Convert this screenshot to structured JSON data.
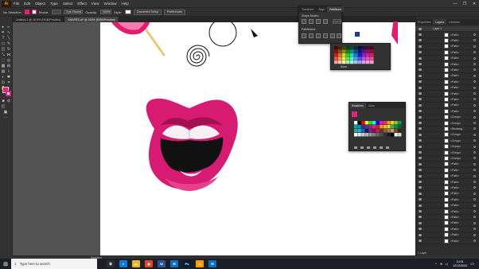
{
  "app": {
    "logo": "Ai"
  },
  "menu": [
    "File",
    "Edit",
    "Object",
    "Type",
    "Select",
    "Effect",
    "View",
    "Window",
    "Help"
  ],
  "window_buttons": [
    "—",
    "❐",
    "✕"
  ],
  "controlbar": {
    "selection": "No Selection",
    "stroke_label": "Stroke:",
    "stroke_value": "",
    "stroke_profile": "3 pt. Round",
    "opacity_label": "Opacity:",
    "opacity_value": "100%",
    "style_label": "Style:",
    "doc_setup": "Document Setup",
    "preferences": "Preferences",
    "fill_color": "#e4207a"
  },
  "doc_tabs": [
    {
      "label": "Untitled-1 @ 16.5% (RGB/Preview)",
      "active": false
    },
    {
      "label": "SHAPES.ai* @ 100% (RGB/Preview)",
      "active": true
    }
  ],
  "pathfinder_panel": {
    "tabs": [
      "Transform",
      "Align",
      "Pathfinder"
    ],
    "shape_modes_label": "Shape Modes:",
    "pathfinders_label": "Pathfinders:",
    "expand_label": "Expand"
  },
  "color_panel": {
    "tabs": [
      "Color"
    ],
    "name_label": "None"
  },
  "swatches_panel": {
    "tabs": [
      "Swatches",
      "Color"
    ]
  },
  "right_panel": {
    "tabs": [
      "Properties",
      "Layers",
      "Libraries"
    ],
    "layer_name": "Layer 1",
    "footer": "1 Layer",
    "rows": [
      "<Path>",
      "<Path>",
      "<Path>",
      "<Path>",
      "<Path>",
      "<Path>",
      "<Path>",
      "<Path>",
      "<Path>",
      "<Path>",
      "<Path>",
      "<Path>",
      "<Path>",
      "<Path>",
      "<Group>",
      "<Group>",
      "<Rectang...",
      "<Group>",
      "<Group>",
      "<Group>",
      "<Group>",
      "<Group>",
      "<Path>",
      "<Path>",
      "<Path>",
      "<Path>",
      "<Path>",
      "<Path>",
      "<Path>",
      "<Path>",
      "<Path>",
      "<Path>",
      "<Path>",
      "<Path>",
      "<Path>",
      "<Path>"
    ]
  },
  "statusbar": {
    "tool": "Selection"
  },
  "taskbar": {
    "search_placeholder": "Type here to search",
    "time": "14:01",
    "date": "12/12/2020",
    "apps": [
      {
        "name": "task-view",
        "color": "#2a2d33",
        "glyph": "⧉"
      },
      {
        "name": "edge",
        "color": "#0f7ad8",
        "glyph": "e"
      },
      {
        "name": "file-explorer",
        "color": "#e8b62a",
        "glyph": "▬"
      },
      {
        "name": "chrome",
        "color": "#e2452d",
        "glyph": "◉"
      },
      {
        "name": "word",
        "color": "#2b579a",
        "glyph": "W"
      },
      {
        "name": "mail",
        "color": "#0e6fc9",
        "glyph": "✉"
      },
      {
        "name": "photoshop",
        "color": "#001e36",
        "glyph": "Ps"
      },
      {
        "name": "illustrator",
        "color": "#ff9a00",
        "glyph": "Ai"
      },
      {
        "name": "mail-2",
        "color": "#0e6fc9",
        "glyph": "✉"
      }
    ]
  },
  "colors": {
    "lip_pink": "#d81b72",
    "lip_dark": "#a3104f",
    "teeth": "#f4f0f3",
    "mouth_interior": "#111111",
    "accent_pink": "#e51a6c"
  }
}
